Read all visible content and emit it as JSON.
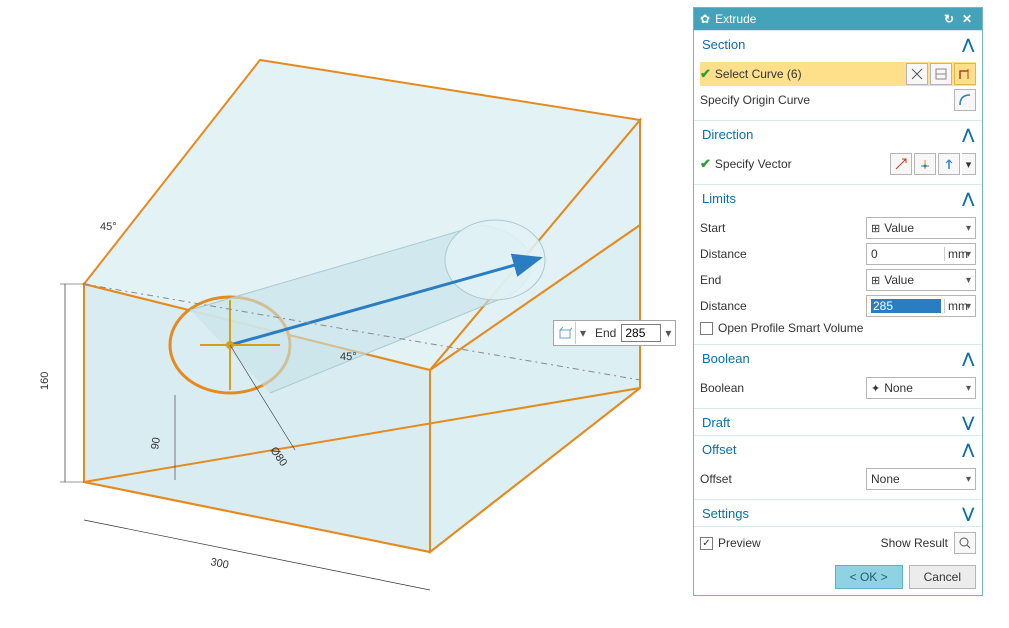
{
  "panel": {
    "title": "Extrude",
    "sections": {
      "section": {
        "title": "Section",
        "open": true
      },
      "direction": {
        "title": "Direction",
        "open": true
      },
      "limits": {
        "title": "Limits",
        "open": true
      },
      "boolean": {
        "title": "Boolean",
        "open": true
      },
      "draft": {
        "title": "Draft",
        "open": false
      },
      "offset": {
        "title": "Offset",
        "open": true
      },
      "settings": {
        "title": "Settings",
        "open": false
      }
    },
    "section_body": {
      "select_curve": "Select Curve (6)",
      "specify_origin": "Specify Origin Curve"
    },
    "direction_body": {
      "specify_vector": "Specify Vector"
    },
    "limits": {
      "start_label": "Start",
      "start_type": "Value",
      "start_dist_label": "Distance",
      "start_dist_value": "0",
      "end_label": "End",
      "end_type": "Value",
      "end_dist_label": "Distance",
      "end_dist_value": "285",
      "unit": "mm",
      "open_profile": "Open Profile Smart Volume"
    },
    "boolean": {
      "label": "Boolean",
      "value": "None"
    },
    "offset": {
      "label": "Offset",
      "value": "None"
    },
    "footer": {
      "preview": "Preview",
      "show_result": "Show Result"
    },
    "buttons": {
      "ok": "< OK >",
      "cancel": "Cancel"
    }
  },
  "float": {
    "label": "End",
    "value": "285"
  },
  "viewport": {
    "dims": {
      "width": "300",
      "height": "160",
      "depth": "90",
      "angle1": "45°",
      "angle2": "45°",
      "dia": "Ø80"
    }
  },
  "icons": {
    "gear": "gear-icon",
    "reset": "reset-icon",
    "close": "close-icon"
  }
}
